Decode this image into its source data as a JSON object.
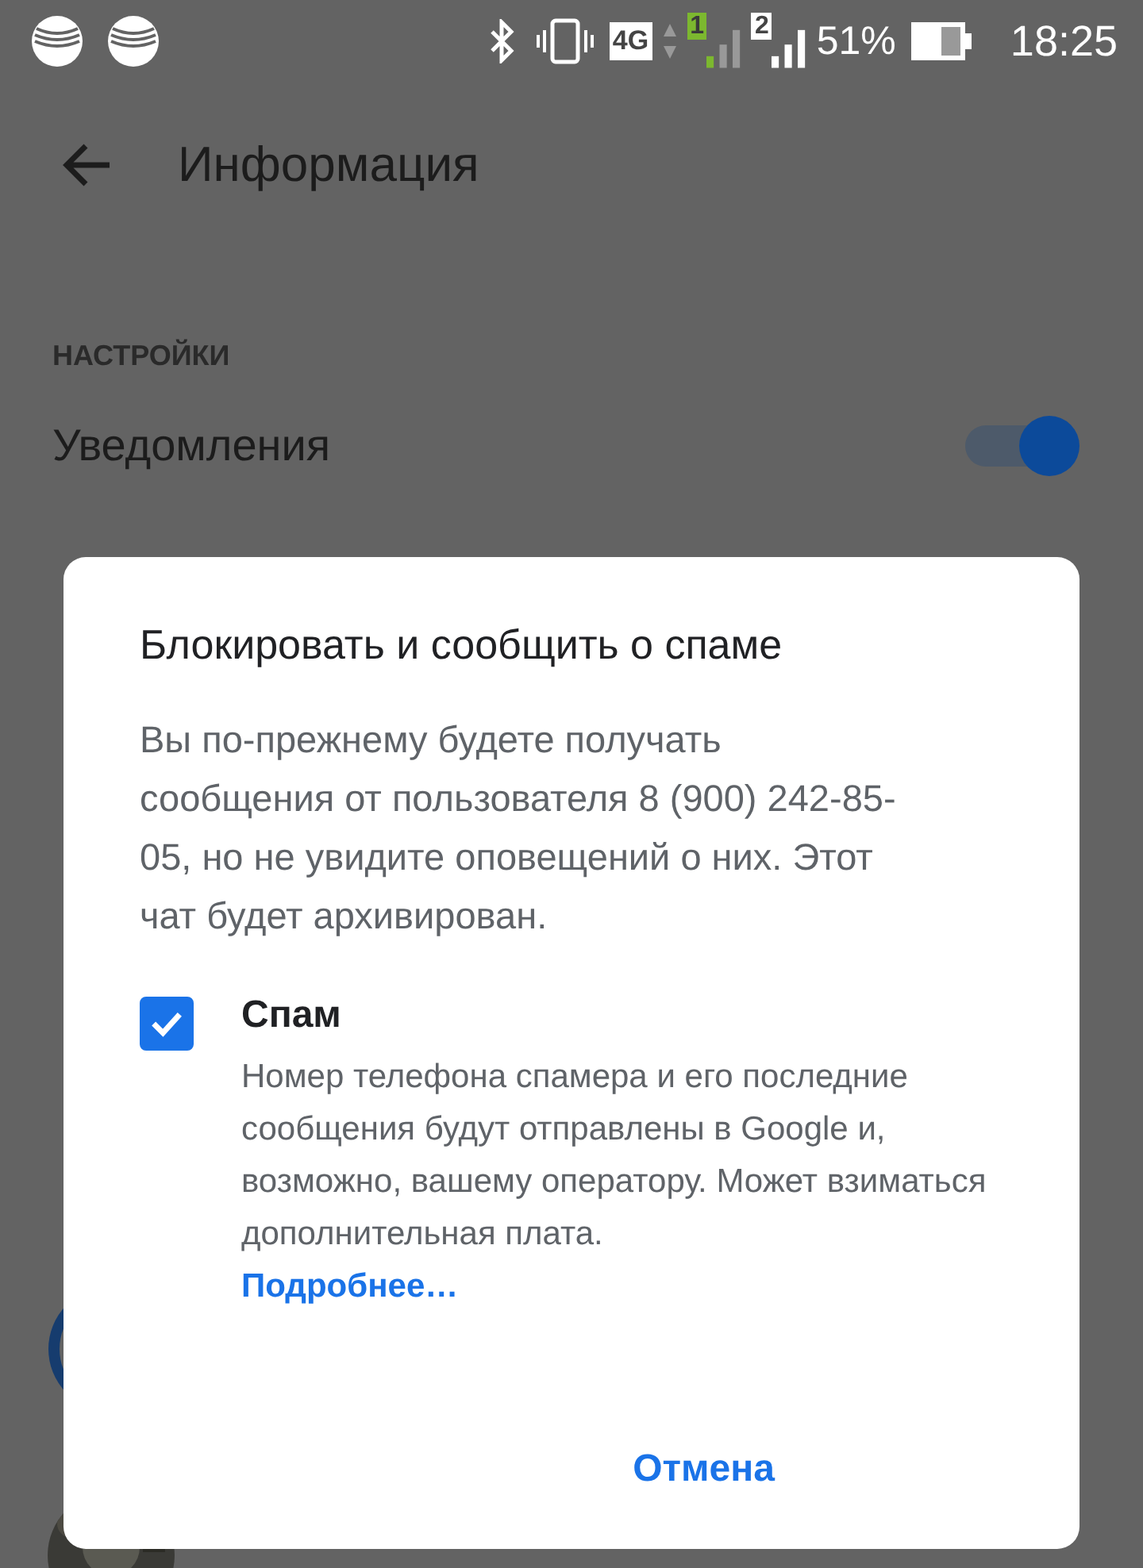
{
  "status_bar": {
    "network": "4G",
    "sim_slots": [
      "1",
      "2"
    ],
    "battery": "51%",
    "time": "18:25"
  },
  "toolbar": {
    "title": "Информация"
  },
  "settings": {
    "header": "НАСТРОЙКИ",
    "notifications": {
      "label": "Уведомления",
      "on": true
    }
  },
  "people": {
    "contacts": [
      {
        "kind": "ring"
      },
      {
        "kind": "picture"
      }
    ]
  },
  "dialog": {
    "title": "Блокировать и сообщить о спаме",
    "body": "Вы по-прежнему будете получать сообщения от пользователя 8 (900) 242-85-05, но не увидите оповещений о них. Этот чат будет архивирован.",
    "checkbox": {
      "label": "Спам",
      "checked": true,
      "description": "Номер телефона спамера и его последние сообщения будут отправлены в Google и, возможно, вашему оператору. Может взиматься дополнительная плата.",
      "link": "Подробнее…"
    },
    "buttons": [
      {
        "label": "Отмена"
      }
    ]
  }
}
